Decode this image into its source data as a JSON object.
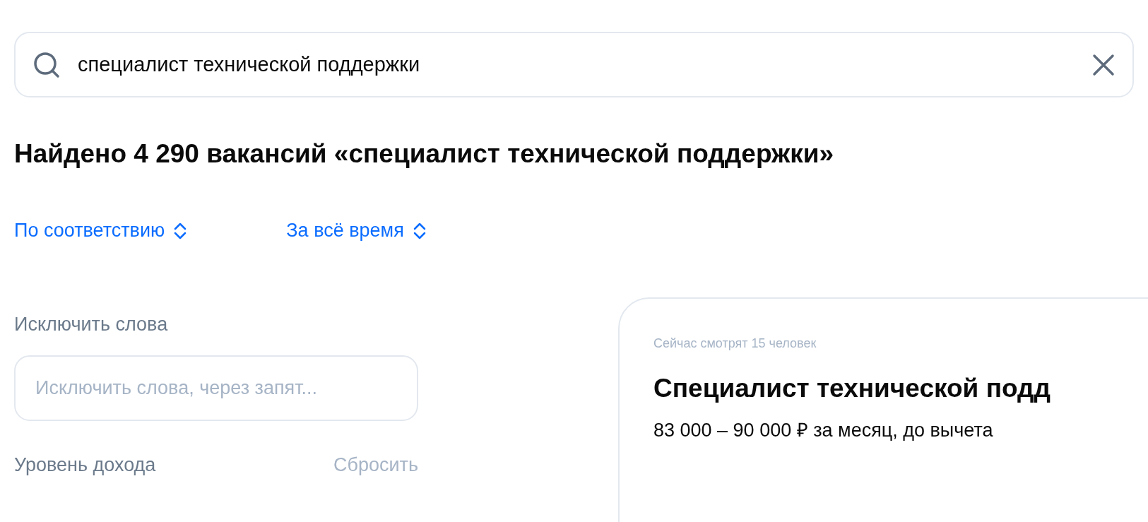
{
  "search": {
    "value": "специалист технической поддержки"
  },
  "heading": "Найдено 4 290 вакансий «специалист технической поддержки»",
  "sort_options": [
    {
      "label": "По соответствию"
    },
    {
      "label": "За всё время"
    }
  ],
  "filters": {
    "exclude_label": "Исключить слова",
    "exclude_placeholder": "Исключить слова, через запят...",
    "income_label": "Уровень дохода",
    "reset": "Сбросить"
  },
  "vacancy": {
    "viewers": "Сейчас смотрят 15 человек",
    "title": "Специалист технической подд",
    "salary": "83 000 – 90 000 ₽ за месяц, до вычета"
  }
}
